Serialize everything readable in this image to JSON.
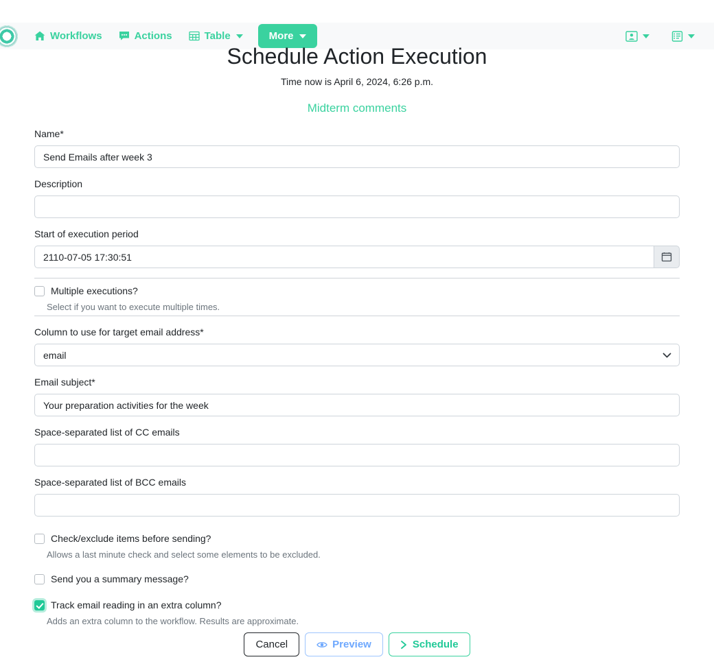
{
  "navbar": {
    "brand_icon": "ontask-ring-logo",
    "items": [
      {
        "label": "Workflows",
        "icon": "home-icon",
        "caret": false
      },
      {
        "label": "Actions",
        "icon": "comment-icon",
        "caret": false
      },
      {
        "label": "Table",
        "icon": "table-grid-icon",
        "caret": true
      }
    ],
    "more_label": "More",
    "right_items": [
      {
        "icon": "user-card-icon",
        "caret": true
      },
      {
        "icon": "notes-list-icon",
        "caret": true
      }
    ]
  },
  "header": {
    "title": "Schedule Action Execution",
    "subtitle": "Time now is April 6, 2024, 6:26 p.m.",
    "action_link": "Midterm comments"
  },
  "form": {
    "name": {
      "label": "Name*",
      "value": "Send Emails after week 3",
      "placeholder": ""
    },
    "description": {
      "label": "Description",
      "value": "",
      "placeholder": ""
    },
    "start": {
      "label": "Start of execution period",
      "value": "2110-07-05 17:30:51",
      "placeholder": "",
      "button_icon": "calendar-icon"
    },
    "multiple_executions": {
      "label": "Multiple executions?",
      "checked": false,
      "help": "Select if you want to execute multiple times."
    },
    "email_column": {
      "label": "Column to use for target email address*",
      "value": "email",
      "options": [
        "email"
      ],
      "caret_icon": "chevron-down-icon"
    },
    "email_subject": {
      "label": "Email subject*",
      "value": "Your preparation activities for the week",
      "placeholder": ""
    },
    "cc_emails": {
      "label": "Space-separated list of CC emails",
      "value": "",
      "placeholder": ""
    },
    "bcc_emails": {
      "label": "Space-separated list of BCC emails",
      "value": "",
      "placeholder": ""
    },
    "check_exclude": {
      "label": "Check/exclude items before sending?",
      "checked": false,
      "help": "Allows a last minute check and select some elements to be excluded."
    },
    "summary_message": {
      "label": "Send you a summary message?",
      "checked": false,
      "help": ""
    },
    "track_reading": {
      "label": "Track email reading in an extra column?",
      "checked": true,
      "help": "Adds an extra column to the workflow. Results are approximate."
    }
  },
  "buttons": {
    "cancel": "Cancel",
    "preview": "Preview",
    "preview_icon": "eye-icon",
    "schedule": "Schedule",
    "schedule_icon": "chevron-right-icon"
  },
  "colors": {
    "brand_green": "#3ad29f",
    "accent_green": "#20c997",
    "preview_blue": "#6ea8fe",
    "navbar_bg": "#f8f9fa",
    "border": "#ced4da",
    "muted_text": "#6c757d"
  }
}
